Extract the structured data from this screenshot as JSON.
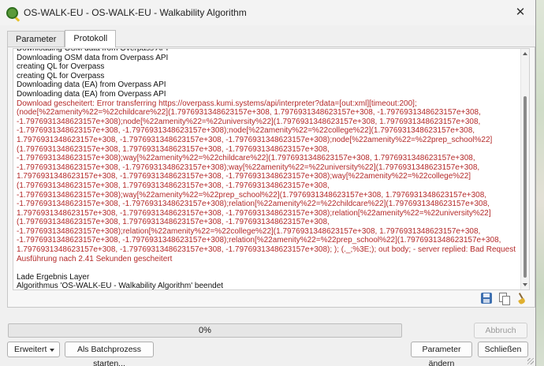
{
  "window": {
    "title": "OS-WALK-EU - OS-WALK-EU - Walkability Algorithm",
    "close_symbol": "✕"
  },
  "tabs": [
    {
      "label": "Parameter",
      "active": false
    },
    {
      "label": "Protokoll",
      "active": true
    }
  ],
  "log": {
    "lines": [
      {
        "text": "Downloading OSM data from Overpass API",
        "type": "info"
      },
      {
        "text": "Downloading OSM data from Overpass API",
        "type": "info"
      },
      {
        "text": "creating QL for Overpass",
        "type": "info"
      },
      {
        "text": "creating QL for Overpass",
        "type": "info"
      },
      {
        "text": "Downloading data (EA) from Overpass API",
        "type": "info"
      },
      {
        "text": "Downloading data (EA) from Overpass API",
        "type": "info"
      },
      {
        "text": "Download gescheitert: Error transferring https://overpass.kumi.systems/api/interpreter?data=[out:xml][timeout:200];",
        "type": "error"
      },
      {
        "text": "(node[%22amenity%22=%22childcare%22](1.7976931348623157e+308, 1.7976931348623157e+308, -1.7976931348623157e+308,",
        "type": "error"
      },
      {
        "text": "-1.7976931348623157e+308);node[%22amenity%22=%22university%22](1.7976931348623157e+308, 1.7976931348623157e+308,",
        "type": "error"
      },
      {
        "text": "-1.7976931348623157e+308, -1.7976931348623157e+308);node[%22amenity%22=%22college%22](1.7976931348623157e+308,",
        "type": "error"
      },
      {
        "text": "1.7976931348623157e+308, -1.7976931348623157e+308, -1.7976931348623157e+308);node[%22amenity%22=%22prep_school%22]",
        "type": "error"
      },
      {
        "text": "(1.7976931348623157e+308, 1.7976931348623157e+308, -1.7976931348623157e+308,",
        "type": "error"
      },
      {
        "text": "-1.7976931348623157e+308);way[%22amenity%22=%22childcare%22](1.7976931348623157e+308, 1.7976931348623157e+308,",
        "type": "error"
      },
      {
        "text": "-1.7976931348623157e+308, -1.7976931348623157e+308);way[%22amenity%22=%22university%22](1.7976931348623157e+308,",
        "type": "error"
      },
      {
        "text": "1.7976931348623157e+308, -1.7976931348623157e+308, -1.7976931348623157e+308);way[%22amenity%22=%22college%22]",
        "type": "error"
      },
      {
        "text": "(1.7976931348623157e+308, 1.7976931348623157e+308, -1.7976931348623157e+308,",
        "type": "error"
      },
      {
        "text": "-1.7976931348623157e+308);way[%22amenity%22=%22prep_school%22](1.7976931348623157e+308, 1.7976931348623157e+308,",
        "type": "error"
      },
      {
        "text": "-1.7976931348623157e+308, -1.7976931348623157e+308);relation[%22amenity%22=%22childcare%22](1.7976931348623157e+308,",
        "type": "error"
      },
      {
        "text": "1.7976931348623157e+308, -1.7976931348623157e+308, -1.7976931348623157e+308);relation[%22amenity%22=%22university%22]",
        "type": "error"
      },
      {
        "text": "(1.7976931348623157e+308, 1.7976931348623157e+308, -1.7976931348623157e+308,",
        "type": "error"
      },
      {
        "text": "-1.7976931348623157e+308);relation[%22amenity%22=%22college%22](1.7976931348623157e+308, 1.7976931348623157e+308,",
        "type": "error"
      },
      {
        "text": "-1.7976931348623157e+308, -1.7976931348623157e+308);relation[%22amenity%22=%22prep_school%22](1.7976931348623157e+308,",
        "type": "error"
      },
      {
        "text": "1.7976931348623157e+308, -1.7976931348623157e+308, -1.7976931348623157e+308); ); (._;%3E;); out body; - server replied: Bad Request",
        "type": "error"
      },
      {
        "text": "Ausführung nach 2.41 Sekunden gescheitert",
        "type": "error"
      },
      {
        "text": "",
        "type": "blank"
      },
      {
        "text": "Lade Ergebnis Layer",
        "type": "info"
      },
      {
        "text": "Algorithmus 'OS-WALK-EU - Walkability Algorithm' beendet",
        "type": "info"
      }
    ],
    "toolbar_icons": [
      "save-icon",
      "copy-icon",
      "clear-icon"
    ]
  },
  "progress": {
    "label": "0%",
    "value": 0
  },
  "buttons": {
    "cancel": "Abbruch",
    "advanced": "Erweitert",
    "batch": "Als Batchprozess starten...",
    "change_parameters": "Parameter ändern",
    "close": "Schließen"
  },
  "colors": {
    "error_text": "#b42a2a",
    "progress_fill": "#06b025"
  }
}
